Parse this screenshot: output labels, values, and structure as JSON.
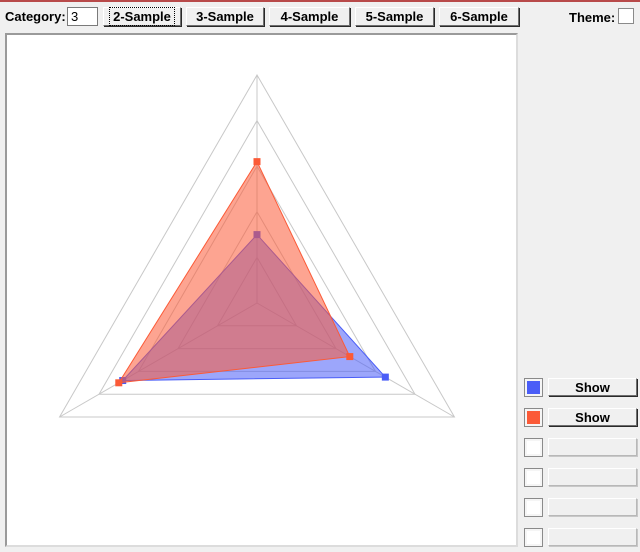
{
  "toolbar": {
    "category_label": "Category:",
    "category_value": "3",
    "buttons": [
      "2-Sample",
      "3-Sample",
      "4-Sample",
      "5-Sample",
      "6-Sample"
    ],
    "active_button": "2-Sample",
    "theme_label": "Theme:"
  },
  "colors": {
    "series1": "#4a5df7",
    "series2": "#fb5a37",
    "grid": "#c8c8c8"
  },
  "legend": [
    {
      "color": "#4a5df7",
      "button_label": "Show"
    },
    {
      "color": "#fb5a37",
      "button_label": "Show"
    },
    {
      "color": "",
      "button_label": ""
    },
    {
      "color": "",
      "button_label": ""
    },
    {
      "color": "",
      "button_label": ""
    },
    {
      "color": "",
      "button_label": ""
    }
  ],
  "chart_data": {
    "type": "radar",
    "axes_count": 3,
    "grid_levels": 5,
    "series": [
      {
        "color": "#4a5df7",
        "values": [
          0.68,
          0.65,
          0.3
        ]
      },
      {
        "color": "#fb5a37",
        "values": [
          0.7,
          0.47,
          0.62
        ]
      }
    ]
  }
}
